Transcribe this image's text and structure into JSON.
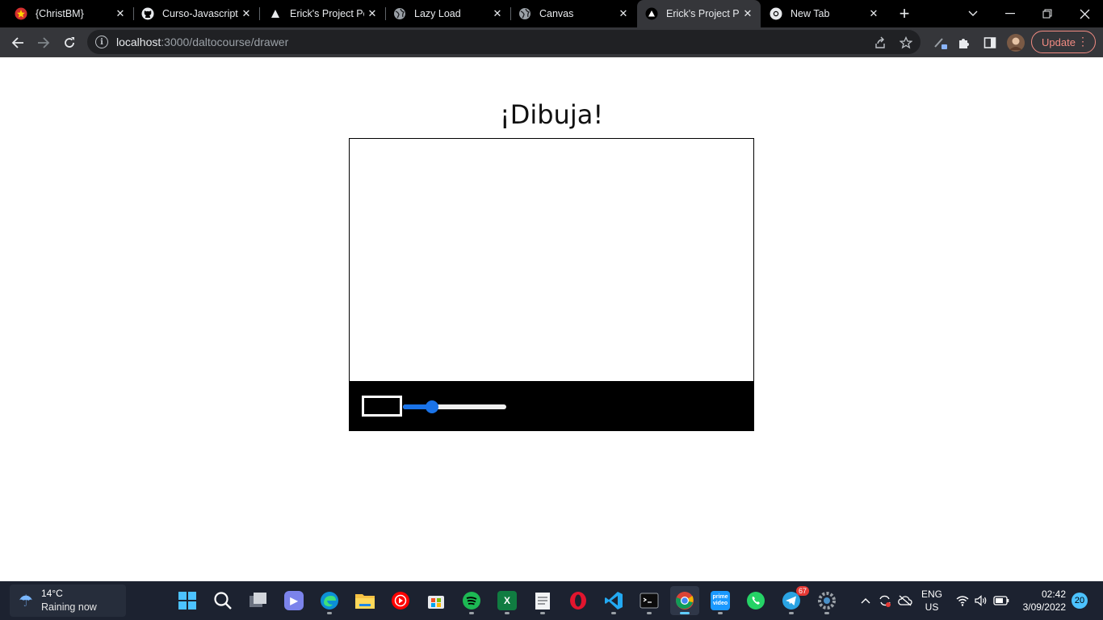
{
  "tabs": [
    {
      "title": "{ChristBM}",
      "icon": "star-favicon-icon",
      "active": false
    },
    {
      "title": "Curso-Javascript-",
      "icon": "github-icon",
      "active": false
    },
    {
      "title": "Erick's Project Po",
      "icon": "triangle-icon",
      "active": false
    },
    {
      "title": "Lazy Load",
      "icon": "globe-icon",
      "active": false
    },
    {
      "title": "Canvas",
      "icon": "globe-icon",
      "active": false
    },
    {
      "title": "Erick's Project Po",
      "icon": "triangle-icon",
      "active": true
    },
    {
      "title": "New Tab",
      "icon": "chrome-icon",
      "active": false
    }
  ],
  "address": {
    "host": "localhost",
    "rest": ":3000/daltocourse/drawer"
  },
  "toolbar": {
    "update_label": "Update"
  },
  "page": {
    "heading": "¡Dibuja!",
    "brush_color": "#000000",
    "brush_size_fraction": 0.25
  },
  "weather": {
    "temp": "14°C",
    "desc": "Raining now"
  },
  "taskbar": {
    "apps": [
      "windows-start-icon",
      "search-icon",
      "task-view-icon",
      "teams-chat-icon",
      "edge-icon",
      "file-explorer-icon",
      "youtube-music-icon",
      "store-icon",
      "spotify-icon",
      "excel-icon",
      "notepad-icon",
      "opera-icon",
      "vscode-icon",
      "terminal-icon",
      "chrome-icon",
      "prime-video-icon",
      "whatsapp-icon",
      "telegram-icon",
      "settings-icon"
    ],
    "telegram_badge": "67",
    "lang_top": "ENG",
    "lang_bottom": "US",
    "time": "02:42",
    "date": "3/09/2022",
    "notifications": "20"
  }
}
